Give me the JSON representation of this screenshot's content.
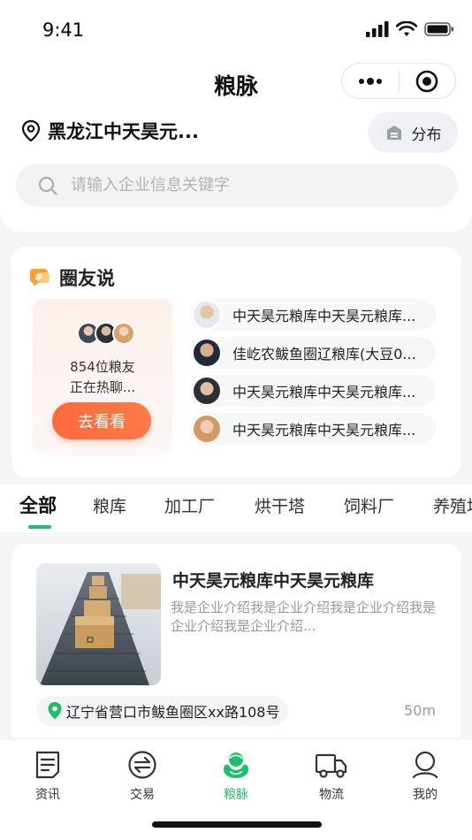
{
  "status_bar": {
    "time": "9:41"
  },
  "nav": {
    "title": "粮脉"
  },
  "location": {
    "text": "黑龙江中天昊元..."
  },
  "distribution_button": {
    "label": "分布"
  },
  "search": {
    "placeholder": "请输入企业信息关键字"
  },
  "circle": {
    "title": "圈友说",
    "count_text": "854位粮友",
    "status_text": "正在热聊...",
    "cta_label": "去看看",
    "topics": [
      {
        "text": "中天昊元粮库中天昊元粮库..."
      },
      {
        "text": "佳屹农鲅鱼圈辽粮库(大豆0..."
      },
      {
        "text": "中天昊元粮库中天昊元粮库..."
      },
      {
        "text": "中天昊元粮库中天昊元粮库..."
      }
    ]
  },
  "tabs": [
    {
      "label": "全部"
    },
    {
      "label": "粮库"
    },
    {
      "label": "加工厂"
    },
    {
      "label": "烘干塔"
    },
    {
      "label": "饲料厂"
    },
    {
      "label": "养殖场"
    }
  ],
  "listing": {
    "title": "中天昊元粮库中天昊元粮库",
    "description": "我是企业介绍我是企业介绍我是企业介绍我是企业介绍我是企业介绍...",
    "address": "辽宁省营口市鲅鱼圈区xx路108号",
    "distance": "50m"
  },
  "bottom_nav": [
    {
      "label": "资讯",
      "icon": "news-icon"
    },
    {
      "label": "交易",
      "icon": "trade-icon"
    },
    {
      "label": "粮脉",
      "icon": "liangmai-icon",
      "active": true
    },
    {
      "label": "物流",
      "icon": "truck-icon"
    },
    {
      "label": "我的",
      "icon": "profile-icon"
    }
  ],
  "colors": {
    "accent_green": "#1ebf6a",
    "cta_orange": "#ff6a3c"
  }
}
